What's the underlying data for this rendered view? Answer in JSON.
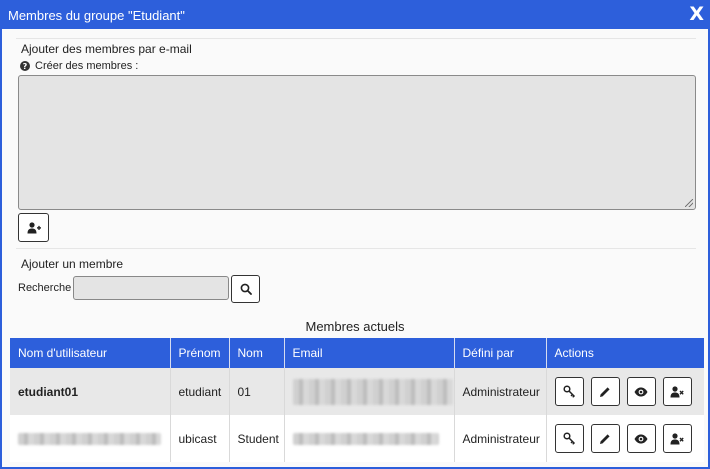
{
  "dialog": {
    "title": "Membres du groupe \"Etudiant\"",
    "close_label": "X"
  },
  "add_by_email": {
    "heading": "Ajouter des membres par e-mail",
    "help_label": "Créer des membres :",
    "textarea_value": ""
  },
  "add_member": {
    "heading": "Ajouter un membre",
    "search_label": "Recherche",
    "search_value": ""
  },
  "members": {
    "heading": "Membres actuels",
    "columns": [
      "Nom d'utilisateur",
      "Prénom",
      "Nom",
      "Email",
      "Défini par",
      "Actions"
    ],
    "rows": [
      {
        "username": "etudiant01",
        "firstname": "etudiant",
        "lastname": "01",
        "email": "",
        "defined_by": "Administrateur"
      },
      {
        "username": "",
        "firstname": "ubicast",
        "lastname": "Student",
        "email": "",
        "defined_by": "Administrateur"
      }
    ]
  },
  "icons": {
    "help": "question-circle-icon",
    "add_user": "user-plus-icon",
    "search": "search-icon",
    "key": "key-icon",
    "edit": "pencil-icon",
    "view": "eye-icon",
    "remove": "user-times-icon"
  },
  "colors": {
    "accent": "#2d5fdb",
    "row_odd": "#e8e8e8",
    "row_even": "#ffffff"
  }
}
